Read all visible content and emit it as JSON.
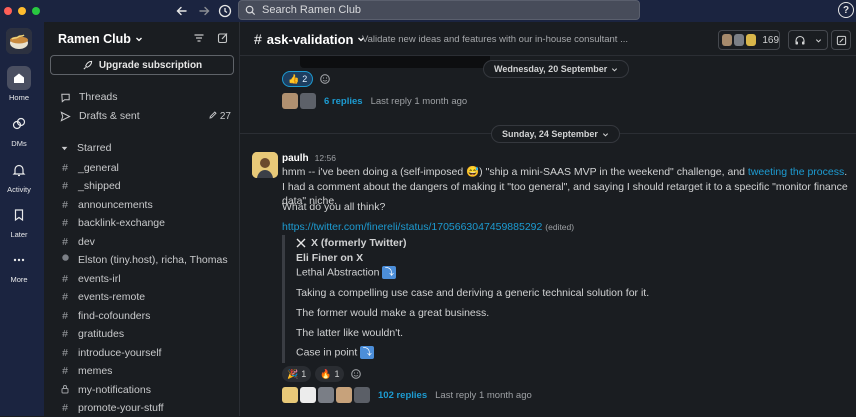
{
  "search": {
    "placeholder": "Search Ramen Club"
  },
  "rail": {
    "home": "Home",
    "dms": "DMs",
    "activity": "Activity",
    "later": "Later",
    "more": "More"
  },
  "sidebar": {
    "workspace_name": "Ramen Club",
    "upgrade_label": "Upgrade subscription",
    "threads": "Threads",
    "drafts": "Drafts & sent",
    "drafts_count": "27",
    "starred": "Starred",
    "channels": [
      "_general",
      "_shipped",
      "announcements",
      "backlink-exchange",
      "dev",
      "Elston (tiny.host), richa, Thomas",
      "events-irl",
      "events-remote",
      "find-cofounders",
      "gratitudes",
      "introduce-yourself",
      "memes",
      "my-notifications",
      "promote-your-stuff"
    ],
    "group_dm_count": "3"
  },
  "header": {
    "channel": "ask-validation",
    "description": "Validate new ideas and features with our in-house consultant ...",
    "member_count": "169"
  },
  "prev_message": {
    "reaction_emoji": "👍",
    "reaction_count": "2",
    "replies": "6 replies",
    "last_reply": "Last reply 1 month ago"
  },
  "dates": {
    "first": "Wednesday, 20 September",
    "second": "Sunday, 24 September"
  },
  "message": {
    "author": "paulh",
    "time": "12:56",
    "line1_a": "hmm -- i've been doing a (self-imposed ",
    "line1_emoji": "😅",
    "line1_b": ") \"ship a mini-SAAS MVP in the weekend\" challenge, and ",
    "line1_link": "tweeting the process",
    "line1_c": ". I had a comment about the dangers of making it \"too general\", and saying I should retarget it to a specific \"monitor finance data\" niche.",
    "line2": "What do you all think?",
    "url": "https://twitter.com/finereli/status/1705663047459885292",
    "edited": "(edited)",
    "unfurl": {
      "source": "X (formerly Twitter)",
      "author": "Eli Finer on X",
      "title": "Lethal Abstraction",
      "p1": "Taking a compelling use case and deriving a generic technical solution for it.",
      "p2": "The former would make a great business.",
      "p3": "The latter like wouldn't.",
      "p4": "Case in point"
    },
    "reactions": [
      {
        "emoji": "🎉",
        "count": "1"
      },
      {
        "emoji": "🔥",
        "count": "1"
      }
    ],
    "replies": "102 replies",
    "last_reply": "Last reply 1 month ago"
  },
  "colors": {
    "accent_link": "#1d9bd1",
    "rail_bg": "#1b2440",
    "bg": "#1a1d21"
  }
}
